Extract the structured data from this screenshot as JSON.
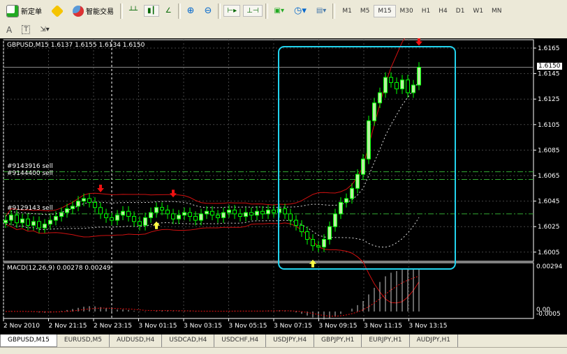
{
  "toolbar": {
    "new_order": "新定单",
    "expert_advisors": "智能交易",
    "timeframes": [
      "M1",
      "M5",
      "M15",
      "M30",
      "H1",
      "H4",
      "D1",
      "W1",
      "MN"
    ],
    "active_timeframe": "M15"
  },
  "toolbar2": {
    "text_label": "A",
    "textbox_label": "T"
  },
  "chart": {
    "header": "GBPUSD,M15  1.6137 1.6155 1.6134 1.6150",
    "current_price": "1.6150",
    "orders": [
      {
        "label": "#9143916 sell",
        "price": 1.6068
      },
      {
        "label": "#9144400 sell",
        "price": 1.6062
      },
      {
        "label": "#9129143 sell",
        "price": 1.6035
      }
    ],
    "macd_label": "MACD(12,26,9) 0.00278 0.00249",
    "macd_axis": [
      "0.00294",
      "0.00",
      "-0.0005"
    ],
    "colors": {
      "bull": "#b8f0a0",
      "bear": "#000000",
      "outline": "#00ff00",
      "bands": "#d01010",
      "highlight": "#22d3ee"
    }
  },
  "chart_data": {
    "type": "candlestick",
    "symbol": "GBPUSD",
    "timeframe": "M15",
    "y_ticks": [
      "1.6165",
      "1.6145",
      "1.6125",
      "1.6105",
      "1.6085",
      "1.6065",
      "1.6045",
      "1.6025",
      "1.6005"
    ],
    "ylim": [
      1.5999,
      1.6171
    ],
    "x_ticks": [
      "2 Nov 2010",
      "2 Nov 21:15",
      "2 Nov 23:15",
      "3 Nov 01:15",
      "3 Nov 03:15",
      "3 Nov 05:15",
      "3 Nov 07:15",
      "3 Nov 09:15",
      "3 Nov 11:15",
      "3 Nov 13:15"
    ],
    "close": [
      1.603,
      1.6034,
      1.6028,
      1.6031,
      1.6026,
      1.6029,
      1.6024,
      1.6027,
      1.603,
      1.6033,
      1.6036,
      1.6039,
      1.6041,
      1.6045,
      1.6047,
      1.6044,
      1.604,
      1.6035,
      1.6032,
      1.603,
      1.6034,
      1.6037,
      1.6033,
      1.6029,
      1.6026,
      1.6032,
      1.6036,
      1.604,
      1.6038,
      1.6035,
      1.6031,
      1.6034,
      1.6036,
      1.6033,
      1.603,
      1.6035,
      1.6037,
      1.6034,
      1.6032,
      1.6036,
      1.6038,
      1.6035,
      1.6033,
      1.6036,
      1.6034,
      1.6037,
      1.6035,
      1.6038,
      1.6036,
      1.6039,
      1.6035,
      1.603,
      1.6026,
      1.6021,
      1.6015,
      1.601,
      1.6009,
      1.6015,
      1.6025,
      1.6035,
      1.6044,
      1.6047,
      1.6055,
      1.6066,
      1.6078,
      1.6108,
      1.6122,
      1.613,
      1.6142,
      1.6138,
      1.6133,
      1.614,
      1.613,
      1.6136,
      1.615
    ],
    "sell_arrows": [
      17,
      30,
      74
    ],
    "buy_arrows": [
      27,
      55
    ]
  }
}
